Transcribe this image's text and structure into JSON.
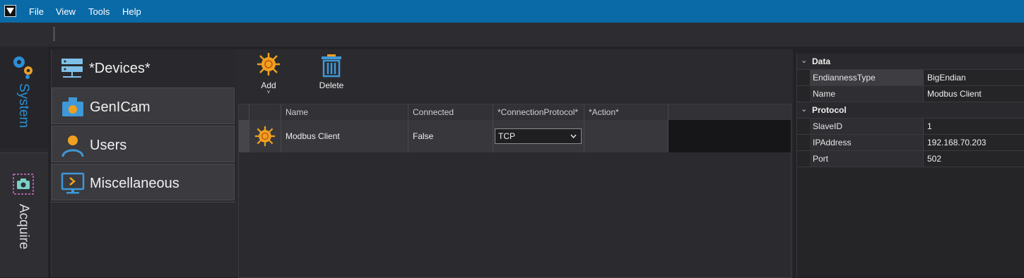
{
  "menu": {
    "items": [
      "File",
      "View",
      "Tools",
      "Help"
    ]
  },
  "rail": {
    "system_label": "System",
    "acquire_label": "Acquire"
  },
  "categories": {
    "active": {
      "label": "*Devices*",
      "icon": "devices-server-icon"
    },
    "items": [
      {
        "label": "GenICam",
        "icon": "camera-icon"
      },
      {
        "label": "Users",
        "icon": "user-icon"
      },
      {
        "label": "Miscellaneous",
        "icon": "monitor-chevron-icon"
      }
    ]
  },
  "toolbar": {
    "add_label": "Add",
    "delete_label": "Delete"
  },
  "grid": {
    "columns": [
      "Name",
      "Connected",
      "*ConnectionProtocol*",
      "*Action*"
    ],
    "rows": [
      {
        "name": "Modbus Client",
        "connected": "False",
        "protocol": "TCP",
        "action": ""
      }
    ]
  },
  "properties": {
    "groups": [
      {
        "name": "Data",
        "props": [
          {
            "name": "EndiannessType",
            "value": "BigEndian"
          },
          {
            "name": "Name",
            "value": "Modbus Client"
          }
        ]
      },
      {
        "name": "Protocol",
        "props": [
          {
            "name": "SlaveID",
            "value": "1"
          },
          {
            "name": "IPAddress",
            "value": "192.168.70.203"
          },
          {
            "name": "Port",
            "value": "502"
          }
        ]
      }
    ]
  },
  "colors": {
    "menubar": "#0a6aa8",
    "accent_blue": "#2b8fd6",
    "device_icon": "#f0a020"
  }
}
